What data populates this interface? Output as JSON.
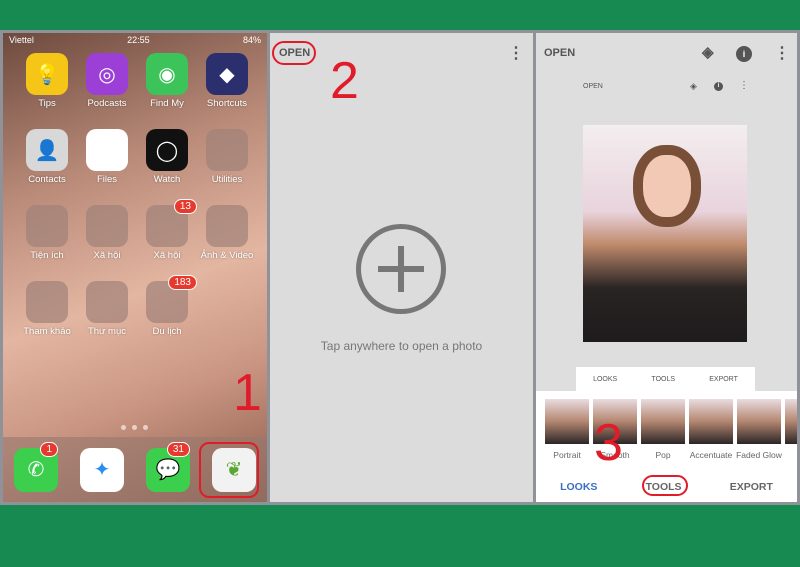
{
  "colors": {
    "background": "#178a52",
    "annotation": "#e11c2a",
    "accent": "#3b6fc5"
  },
  "panel1": {
    "status": {
      "carrier": "Viettel",
      "time": "22:55",
      "battery": "84%"
    },
    "apps": [
      {
        "label": "Tips",
        "icon": "lightbulb-icon",
        "color": "#f5c518"
      },
      {
        "label": "Podcasts",
        "icon": "podcasts-icon",
        "color": "#9b3fd6"
      },
      {
        "label": "Find My",
        "icon": "find-my-icon",
        "color": "#3cc35a"
      },
      {
        "label": "Shortcuts",
        "icon": "shortcuts-icon",
        "color": "#2b2f6e"
      },
      {
        "label": "Contacts",
        "icon": "contacts-icon",
        "color": "#d8d8d8"
      },
      {
        "label": "Files",
        "icon": "folder-icon",
        "color": "#ffffff"
      },
      {
        "label": "Watch",
        "icon": "watch-icon",
        "color": "#111111"
      },
      {
        "label": "Utilities",
        "icon": "folder-icon",
        "color": ""
      },
      {
        "label": "Tiện ích",
        "icon": "folder-icon",
        "color": ""
      },
      {
        "label": "Xã hội",
        "icon": "folder-icon",
        "color": ""
      },
      {
        "label": "Xã hội",
        "icon": "folder-icon",
        "color": "",
        "badge": "13"
      },
      {
        "label": "Ảnh & Video",
        "icon": "folder-icon",
        "color": ""
      },
      {
        "label": "Tham khảo",
        "icon": "folder-icon",
        "color": ""
      },
      {
        "label": "Thư mục",
        "icon": "folder-icon",
        "color": ""
      },
      {
        "label": "Du lịch",
        "icon": "folder-icon",
        "color": "",
        "badge": "183"
      }
    ],
    "dock": [
      {
        "icon": "phone-icon",
        "badge": "1",
        "color": "#3ccf4e"
      },
      {
        "icon": "safari-icon",
        "badge": "",
        "color": "#ffffff"
      },
      {
        "icon": "messages-icon",
        "badge": "31",
        "color": "#3ccf4e"
      },
      {
        "icon": "snapseed-icon",
        "badge": "",
        "color": "#f2f2f2"
      }
    ],
    "step": "1"
  },
  "panel2": {
    "open": "OPEN",
    "hint": "Tap anywhere to open a photo",
    "step": "2"
  },
  "panel3": {
    "open": "OPEN",
    "open_small": "OPEN",
    "tabs": [
      "LOOKS",
      "TOOLS",
      "EXPORT"
    ],
    "looks": [
      "Portrait",
      "Smooth",
      "Pop",
      "Accentuate",
      "Faded Glow",
      "M"
    ],
    "nav": {
      "looks": "LOOKS",
      "tools": "TOOLS",
      "export": "EXPORT"
    },
    "step": "3"
  }
}
